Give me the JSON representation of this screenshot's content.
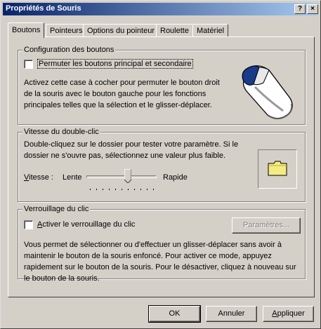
{
  "window": {
    "title": "Propriétés de Souris",
    "help_label": "?",
    "close_label": "×"
  },
  "tabs": [
    {
      "label": "Boutons",
      "active": true
    },
    {
      "label": "Pointeurs",
      "active": false
    },
    {
      "label": "Options du pointeur",
      "active": false
    },
    {
      "label": "Roulette",
      "active": false
    },
    {
      "label": "Matériel",
      "active": false
    }
  ],
  "buttons_config": {
    "group_label": "Configuration des boutons",
    "checkbox_label": "Permuter les boutons principal et secondaire",
    "checked": false,
    "description": "Activez cette case à cocher pour permuter le bouton droit de la souris avec le bouton gauche pour les fonctions principales telles que la sélection et le glisser-déplacer.",
    "icon": "mouse-icon"
  },
  "double_click": {
    "group_label": "Vitesse du double-clic",
    "description": "Double-cliquez sur le dossier pour tester votre paramètre. Si le dossier ne s'ouvre pas, sélectionnez une valeur plus faible.",
    "speed_label": "Vitesse :",
    "slow_label": "Lente",
    "fast_label": "Rapide",
    "slider_value": 0.6,
    "slider_ticks": 11,
    "folder_icon": "folder-icon"
  },
  "click_lock": {
    "group_label": "Verrouillage du clic",
    "checkbox_label": "Activer le verrouillage du clic",
    "checked": false,
    "settings_button": "Paramètres...",
    "settings_enabled": false,
    "description": "Vous permet de sélectionner ou d'effectuer un glisser-déplacer sans avoir à maintenir le bouton de la souris enfoncé. Pour activer ce mode, appuyez rapidement sur le bouton de la souris. Pour le désactiver, cliquez à nouveau sur le bouton de la souris."
  },
  "footer": {
    "ok": "OK",
    "cancel": "Annuler",
    "apply": "Appliquer"
  },
  "colors": {
    "face": "#d4d0c8",
    "title_start": "#0a246a",
    "title_end": "#a6caf0",
    "folder": "#f4ec80"
  }
}
